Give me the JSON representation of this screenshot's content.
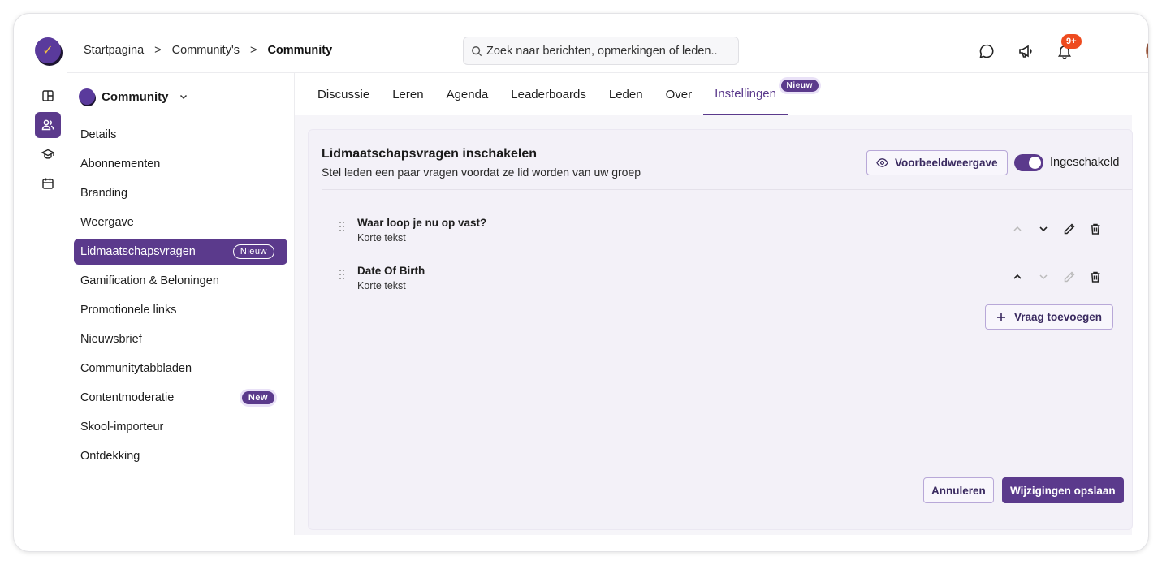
{
  "breadcrumb": {
    "home": "Startpagina",
    "communities": "Community's",
    "current": "Community",
    "separator": ">"
  },
  "search": {
    "placeholder": "Zoek naar berichten, opmerkingen of leden.."
  },
  "notifications": {
    "count": "9+"
  },
  "community": {
    "name": "Community"
  },
  "sidebar": {
    "items": [
      {
        "label": "Details"
      },
      {
        "label": "Abonnementen"
      },
      {
        "label": "Branding"
      },
      {
        "label": "Weergave"
      },
      {
        "label": "Lidmaatschapsvragen",
        "badge": "Nieuw",
        "active": true
      },
      {
        "label": "Gamification & Beloningen"
      },
      {
        "label": "Promotionele links"
      },
      {
        "label": "Nieuwsbrief"
      },
      {
        "label": "Communitytabbladen"
      },
      {
        "label": "Contentmoderatie",
        "badge": "New"
      },
      {
        "label": "Skool-importeur"
      },
      {
        "label": "Ontdekking"
      }
    ]
  },
  "tabs": [
    {
      "label": "Discussie"
    },
    {
      "label": "Leren"
    },
    {
      "label": "Agenda"
    },
    {
      "label": "Leaderboards"
    },
    {
      "label": "Leden"
    },
    {
      "label": "Over"
    },
    {
      "label": "Instellingen",
      "badge": "Nieuw",
      "active": true
    }
  ],
  "panel": {
    "title": "Lidmaatschapsvragen inschakelen",
    "subtitle": "Stel leden een paar vragen voordat ze lid worden van uw groep",
    "preview_label": "Voorbeeldweergave",
    "toggle_label": "Ingeschakeld",
    "toggle_on": true,
    "questions": [
      {
        "title": "Waar loop je nu op vast?",
        "type": "Korte tekst"
      },
      {
        "title": "Date Of Birth",
        "type": "Korte tekst"
      }
    ],
    "add_label": "Vraag toevoegen",
    "cancel_label": "Annuleren",
    "save_label": "Wijzigingen opslaan"
  },
  "colors": {
    "accent": "#5b3a8c",
    "notification": "#ee4b1f"
  },
  "icons": {
    "rail": [
      "layout-icon",
      "users-icon",
      "graduation-cap-icon",
      "calendar-icon"
    ],
    "top": [
      "chat-icon",
      "megaphone-icon",
      "bell-icon"
    ],
    "question_actions": [
      "chevron-up-icon",
      "chevron-down-icon",
      "pencil-icon",
      "trash-icon"
    ]
  }
}
